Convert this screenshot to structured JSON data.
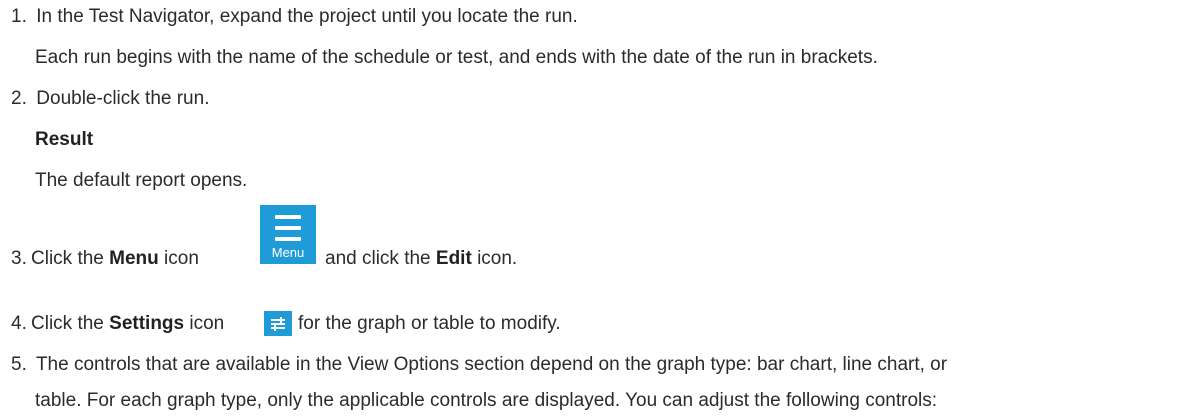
{
  "steps": [
    {
      "number": "1.",
      "text": "In the Test Navigator, expand the project until you locate the run.",
      "detail": "Each run begins with the name of the schedule or test, and ends with the date of the run in brackets."
    },
    {
      "number": "2.",
      "text": "Double-click the run.",
      "result_heading": "Result",
      "result_text": "The default report opens."
    },
    {
      "number": "3.",
      "pre": "Click the ",
      "bold1": "Menu",
      "mid": " icon",
      "icon_label": "Menu",
      "post": " and click the ",
      "bold2": "Edit",
      "end": " icon."
    },
    {
      "number": "4.",
      "pre": "Click the ",
      "bold1": "Settings",
      "mid": " icon",
      "post": " for the graph or table to modify."
    },
    {
      "number": "5.",
      "line1": "The controls that are available in the View Options section depend on the graph type: bar chart, line chart, or",
      "line2": "table. For each graph type, only the applicable controls are displayed. You can adjust the following controls:"
    }
  ],
  "icons": {
    "menu": "menu-icon",
    "settings": "settings-sliders-icon",
    "accent_color": "#1f9bd7"
  }
}
